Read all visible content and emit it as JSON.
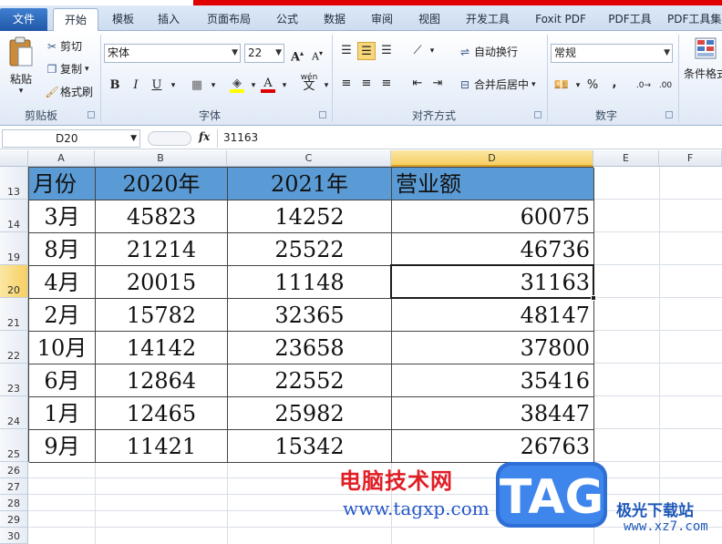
{
  "tabs": [
    "文件",
    "开始",
    "模板",
    "插入",
    "页面布局",
    "公式",
    "数据",
    "审阅",
    "视图",
    "开发工具",
    "Foxit PDF",
    "PDF工具",
    "PDF工具集"
  ],
  "active_tab": "开始",
  "ribbon": {
    "clipboard": {
      "paste": "粘贴",
      "cut": "剪切",
      "copy": "复制",
      "format_painter": "格式刷",
      "group": "剪贴板"
    },
    "font": {
      "name": "宋体",
      "size": "22",
      "bold": "B",
      "italic": "I",
      "underline": "U",
      "font_color_letter": "A",
      "wen": "wén",
      "group": "字体"
    },
    "alignment": {
      "wrap": "自动换行",
      "merge": "合并后居中",
      "group": "对齐方式"
    },
    "number": {
      "format": "常规",
      "percent": "%",
      "comma": ",",
      "group": "数字"
    },
    "styles": {
      "conditional": "条件格式"
    }
  },
  "formula_bar": {
    "name_box": "D20",
    "fx": "fx",
    "value": "31163"
  },
  "columns": [
    "A",
    "B",
    "C",
    "D",
    "E",
    "F"
  ],
  "selected_column": "D",
  "rows": [
    "13",
    "14",
    "19",
    "20",
    "21",
    "22",
    "23",
    "24",
    "25",
    "26",
    "27",
    "28",
    "29",
    "30"
  ],
  "selected_row": "20",
  "table": {
    "headers": [
      "月份",
      "2020年",
      "2021年",
      "营业额"
    ],
    "data": [
      [
        "3月",
        "45823",
        "14252",
        "60075"
      ],
      [
        "8月",
        "21214",
        "25522",
        "46736"
      ],
      [
        "4月",
        "20015",
        "11148",
        "31163"
      ],
      [
        "2月",
        "15782",
        "32365",
        "48147"
      ],
      [
        "10月",
        "14142",
        "23658",
        "37800"
      ],
      [
        "6月",
        "12864",
        "22552",
        "35416"
      ],
      [
        "1月",
        "12465",
        "25982",
        "38447"
      ],
      [
        "9月",
        "11421",
        "15342",
        "26763"
      ]
    ]
  },
  "watermark": {
    "title": "电脑技术网",
    "url": "www.tagxp.com",
    "badge": "TAG",
    "site_name": "极光下载站",
    "site_url": "www.xz7.com"
  },
  "colors": {
    "header_fill": "#5b9bd5",
    "selection": "#f7cf61",
    "accent_red": "#e01e25"
  }
}
